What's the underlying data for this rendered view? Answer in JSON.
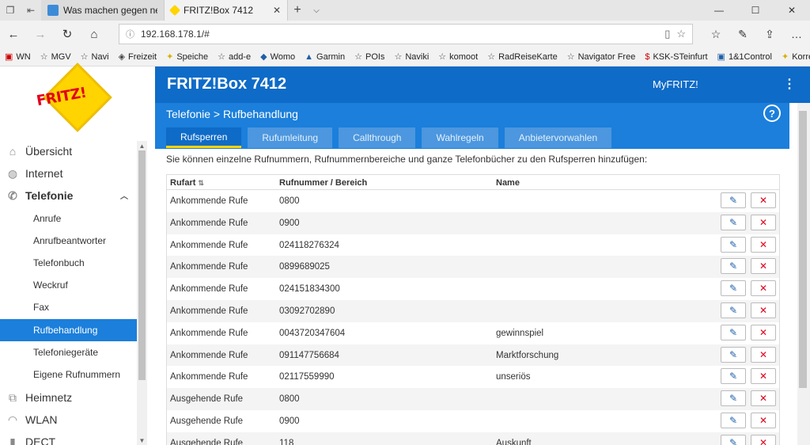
{
  "browser": {
    "tabs": [
      {
        "title": "Was machen gegen nervige",
        "active": false
      },
      {
        "title": "FRITZ!Box 7412",
        "active": true
      }
    ],
    "url": "192.168.178.1/#",
    "favorites": [
      "WN",
      "MGV",
      "Navi",
      "Freizeit",
      "Speiche",
      "add-e",
      "Womo",
      "Garmin",
      "POIs",
      "Naviki",
      "komoot",
      "RadReiseKarte",
      "Navigator Free",
      "KSK-STeinfurt",
      "1&1Control",
      "Korrell"
    ]
  },
  "fritz": {
    "title": "FRITZ!Box 7412",
    "myfritz": "MyFRITZ!",
    "breadcrumb": "Telefonie > Rufbehandlung",
    "tabs": [
      "Rufsperren",
      "Rufumleitung",
      "Callthrough",
      "Wahlregeln",
      "Anbietervorwahlen"
    ],
    "active_tab": "Rufsperren",
    "help": "?"
  },
  "sidebar": {
    "items": [
      {
        "label": "Übersicht",
        "level": "main",
        "icon": "home-icon"
      },
      {
        "label": "Internet",
        "level": "main",
        "icon": "globe-icon"
      },
      {
        "label": "Telefonie",
        "level": "main",
        "icon": "phone-icon",
        "expanded": true
      },
      {
        "label": "Anrufe",
        "level": "sub"
      },
      {
        "label": "Anrufbeantworter",
        "level": "sub"
      },
      {
        "label": "Telefonbuch",
        "level": "sub"
      },
      {
        "label": "Weckruf",
        "level": "sub"
      },
      {
        "label": "Fax",
        "level": "sub"
      },
      {
        "label": "Rufbehandlung",
        "level": "sub",
        "selected": true
      },
      {
        "label": "Telefoniegeräte",
        "level": "sub"
      },
      {
        "label": "Eigene Rufnummern",
        "level": "sub"
      },
      {
        "label": "Heimnetz",
        "level": "main",
        "icon": "network-icon"
      },
      {
        "label": "WLAN",
        "level": "main",
        "icon": "wifi-icon"
      },
      {
        "label": "DECT",
        "level": "main",
        "icon": "dect-icon"
      }
    ]
  },
  "content": {
    "intro": "Sie können einzelne Rufnummern, Rufnummernbereiche und ganze Telefonbücher zu den Rufsperren hinzufügen:",
    "columns": [
      "Rufart",
      "Rufnummer / Bereich",
      "Name"
    ],
    "rows": [
      [
        "Ankommende Rufe",
        "0800",
        ""
      ],
      [
        "Ankommende Rufe",
        "0900",
        ""
      ],
      [
        "Ankommende Rufe",
        "024118276324",
        ""
      ],
      [
        "Ankommende Rufe",
        "0899689025",
        ""
      ],
      [
        "Ankommende Rufe",
        "024151834300",
        ""
      ],
      [
        "Ankommende Rufe",
        "03092702890",
        ""
      ],
      [
        "Ankommende Rufe",
        "0043720347604",
        "gewinnspiel"
      ],
      [
        "Ankommende Rufe",
        "091147756684",
        "Marktforschung"
      ],
      [
        "Ankommende Rufe",
        "02117559990",
        "unseriös"
      ],
      [
        "Ausgehende Rufe",
        "0800",
        ""
      ],
      [
        "Ausgehende Rufe",
        "0900",
        ""
      ],
      [
        "Ausgehende Rufe",
        "118",
        "Auskunft"
      ]
    ],
    "edit_icon": "pencil-icon",
    "delete_icon": "x-icon"
  }
}
